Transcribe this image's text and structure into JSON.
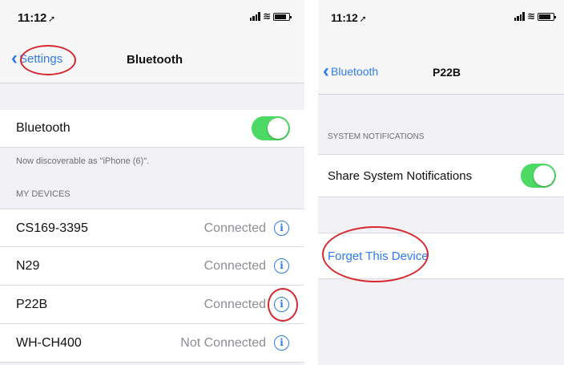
{
  "left": {
    "status_time": "11:12",
    "nav": {
      "back_label": "Settings",
      "title": "Bluetooth"
    },
    "bluetooth_label": "Bluetooth",
    "discoverable_text": "Now discoverable as \"iPhone (6)\".",
    "section_header": "MY DEVICES",
    "devices": [
      {
        "name": "CS169-3395",
        "status": "Connected"
      },
      {
        "name": "N29",
        "status": "Connected"
      },
      {
        "name": "P22B",
        "status": "Connected"
      },
      {
        "name": "WH-CH400",
        "status": "Not Connected"
      }
    ],
    "info_glyph": "i"
  },
  "right": {
    "status_time": "11:12",
    "nav": {
      "back_label": "Bluetooth",
      "title": "P22B"
    },
    "section_header": "SYSTEM NOTIFICATIONS",
    "share_label": "Share System Notifications",
    "forget_label": "Forget This Device"
  },
  "icons": {
    "back": "chevron-left-icon",
    "info": "info-circle-icon",
    "signal": "cellular-signal-icon",
    "wifi": "wifi-icon",
    "battery": "battery-icon",
    "location": "location-arrow-icon"
  },
  "colors": {
    "accent": "#2f7bf6",
    "toggle_on": "#4cd964",
    "highlight_ring": "#d8282f",
    "background": "#f2f2f6"
  },
  "toggles": {
    "bluetooth": true,
    "share_notifications": true
  }
}
